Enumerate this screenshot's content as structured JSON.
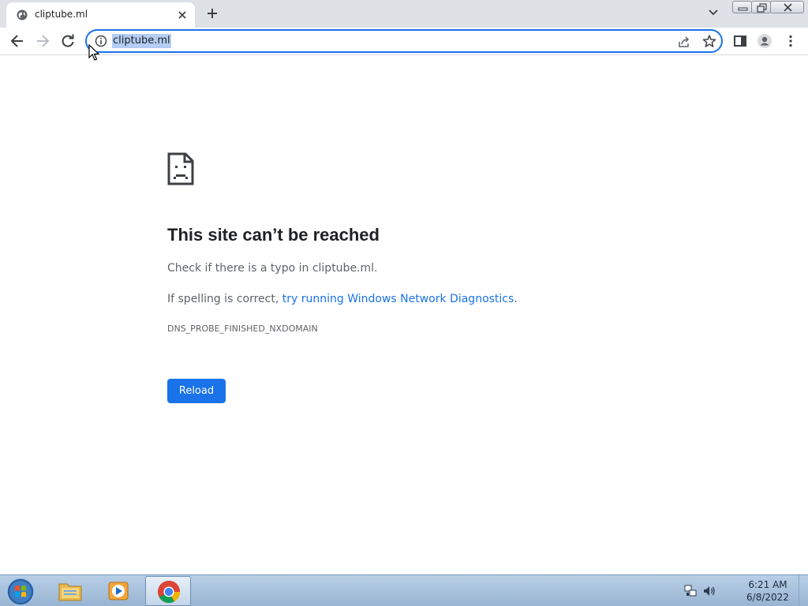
{
  "browser": {
    "tab": {
      "title": "cliptube.ml"
    },
    "omnibox": {
      "url": "cliptube.ml"
    }
  },
  "error_page": {
    "title": "This site can’t be reached",
    "line1": "Check if there is a typo in cliptube.ml.",
    "line2_prefix": "If spelling is correct, ",
    "line2_link": "try running Windows Network Diagnostics",
    "line2_suffix": ".",
    "error_code": "DNS_PROBE_FINISHED_NXDOMAIN",
    "reload_label": "Reload"
  },
  "taskbar": {
    "apps": [
      "file-explorer",
      "media-player",
      "chrome"
    ],
    "active_app": "chrome",
    "clock": {
      "time": "6:21 AM",
      "date": "6/8/2022"
    }
  },
  "colors": {
    "accent": "#1a73e8",
    "tabstrip": "#dee1e6",
    "url_highlight": "#b3cdf4",
    "title_text": "#202124",
    "body_text": "#5f6368"
  }
}
